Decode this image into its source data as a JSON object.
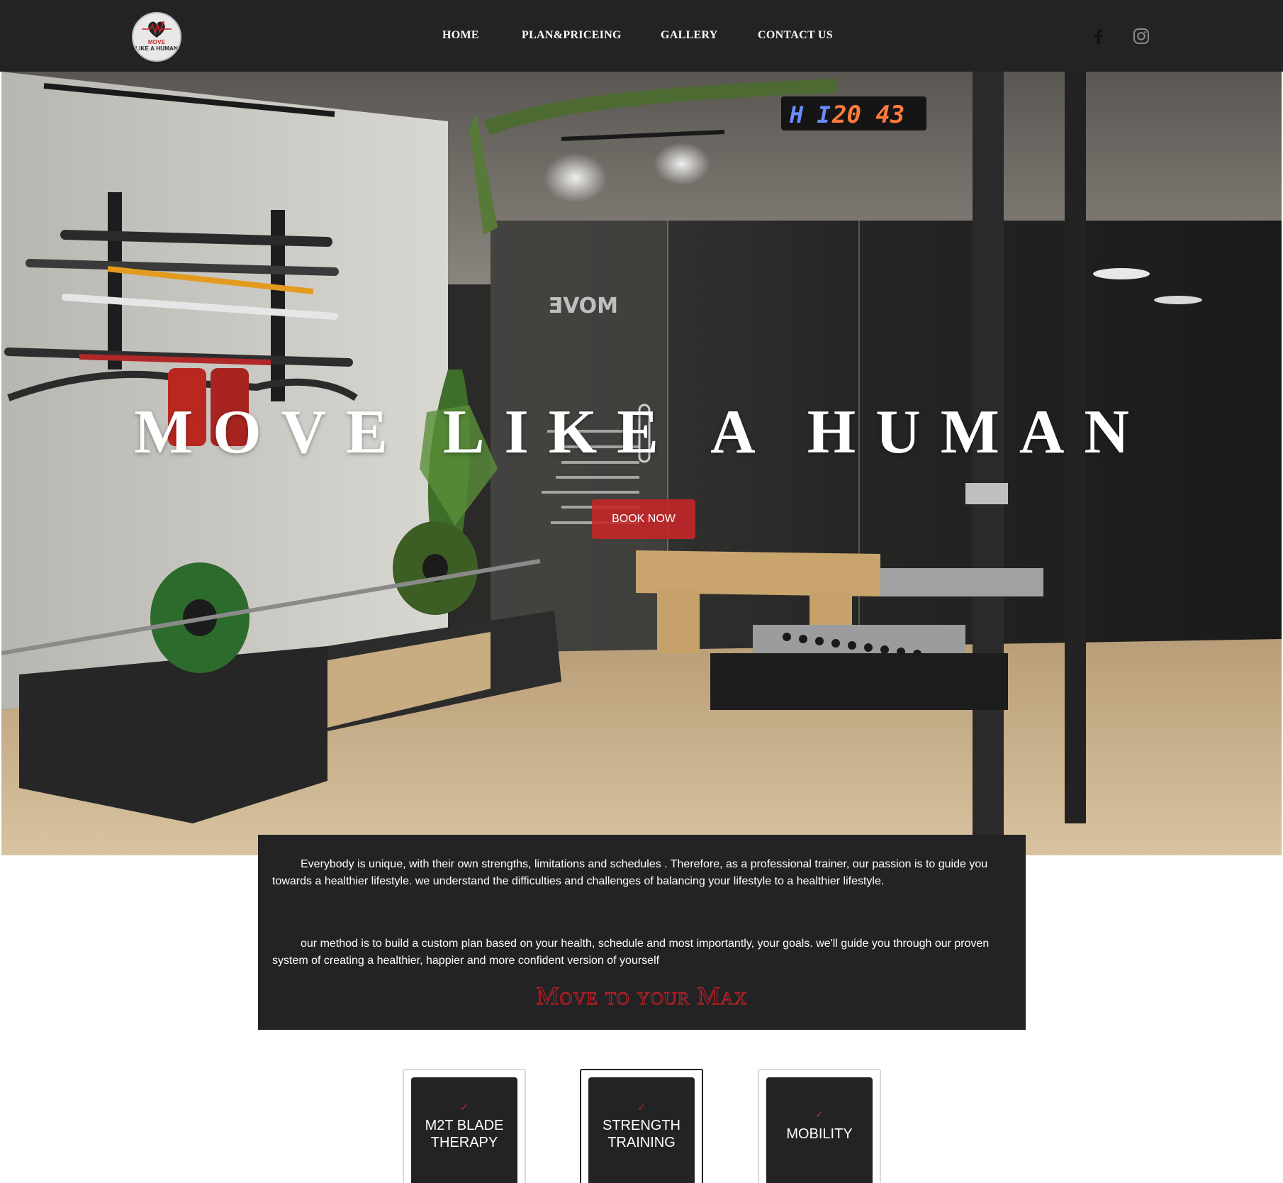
{
  "brand": {
    "logo_line1": "MOVE",
    "logo_line2": "LIKE A HUMAN",
    "accent_color": "#c0282d",
    "dark_color": "#232325"
  },
  "nav": {
    "items": [
      {
        "label": "HOME"
      },
      {
        "label": "PLAN&PRICEING"
      },
      {
        "label": "GALLERY"
      },
      {
        "label": "CONTACT US"
      }
    ],
    "social": [
      {
        "icon": "facebook-icon"
      },
      {
        "icon": "instagram-icon"
      }
    ]
  },
  "hero": {
    "title": "MOVE LIKE A HUMAN",
    "cta_label": "BOOK NOW",
    "scoreboard": {
      "left": "H I",
      "right": "20 43"
    }
  },
  "about": {
    "paragraph1": "Everybody is unique, with their own strengths, limitations and schedules . Therefore, as a professional trainer, our passion is to guide you towards a healthier lifestyle. we understand the difficulties and challenges of balancing your lifestyle to a healthier lifestyle.",
    "paragraph2": "our method is to build a custom plan based on your health, schedule and most importantly, your goals. we'll guide you through our proven system of creating a healthier, happier and more confident version of yourself",
    "motto": "Move to your Max"
  },
  "services": [
    {
      "check": "✓",
      "label_line1": "M2T BLADE",
      "label_line2": "THERAPY"
    },
    {
      "check": "✓",
      "label_line1": "STRENGTH",
      "label_line2": "TRAINING"
    },
    {
      "check": "✓",
      "label_line1": "MOBILITY",
      "label_line2": ""
    }
  ]
}
